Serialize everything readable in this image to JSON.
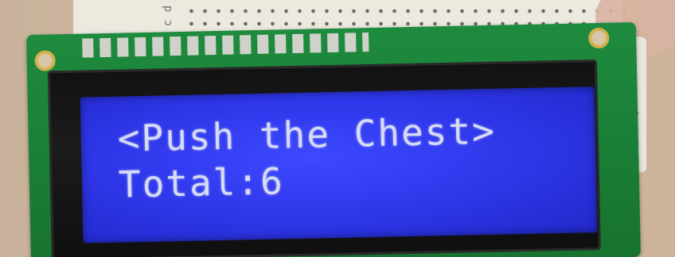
{
  "breadboard": {
    "row_labels": [
      "d",
      "c"
    ],
    "rail_minus": "-",
    "rail_plus": "+"
  },
  "lcd": {
    "line1": "<Push the Chest>",
    "line2": "Total:6",
    "backlight_color": "#2f37ea",
    "text_color": "#d6dbf5"
  },
  "pcb": {
    "color": "#1e8b3e"
  }
}
